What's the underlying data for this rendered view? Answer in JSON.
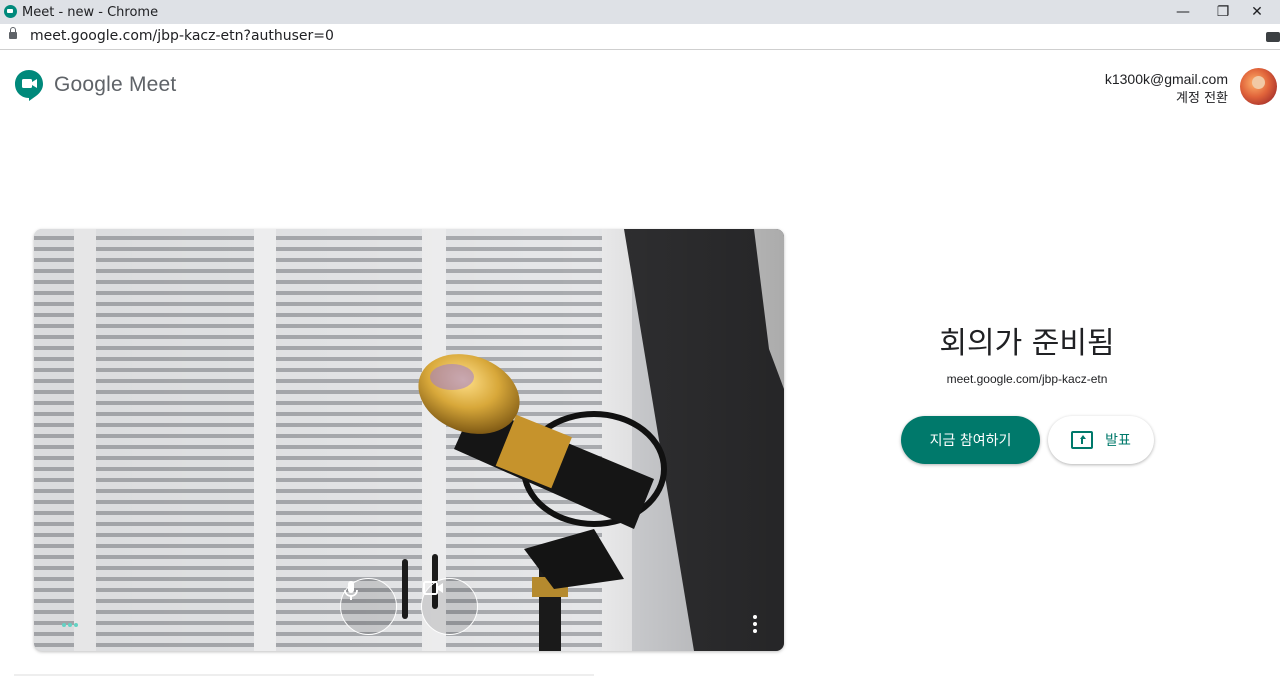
{
  "browser": {
    "window_title": "Meet - new - Chrome",
    "url": "meet.google.com/jbp-kacz-etn?authuser=0",
    "controls": {
      "minimize": "—",
      "restore": "❐",
      "close": "✕"
    }
  },
  "header": {
    "product_name": "Google Meet",
    "account_email": "k1300k@gmail.com",
    "switch_account": "계정 전환"
  },
  "preview": {
    "mic_icon": "microphone-icon",
    "camera_icon": "video-camera-icon",
    "more_icon": "more-vert-icon"
  },
  "join_panel": {
    "title": "회의가 준비됨",
    "meeting_link": "meet.google.com/jbp-kacz-etn",
    "join_button": "지금 참여하기",
    "present_button": "발표"
  },
  "colors": {
    "accent": "#00796b",
    "logo_green": "#00897b",
    "audio_level": "#64d2c4"
  }
}
